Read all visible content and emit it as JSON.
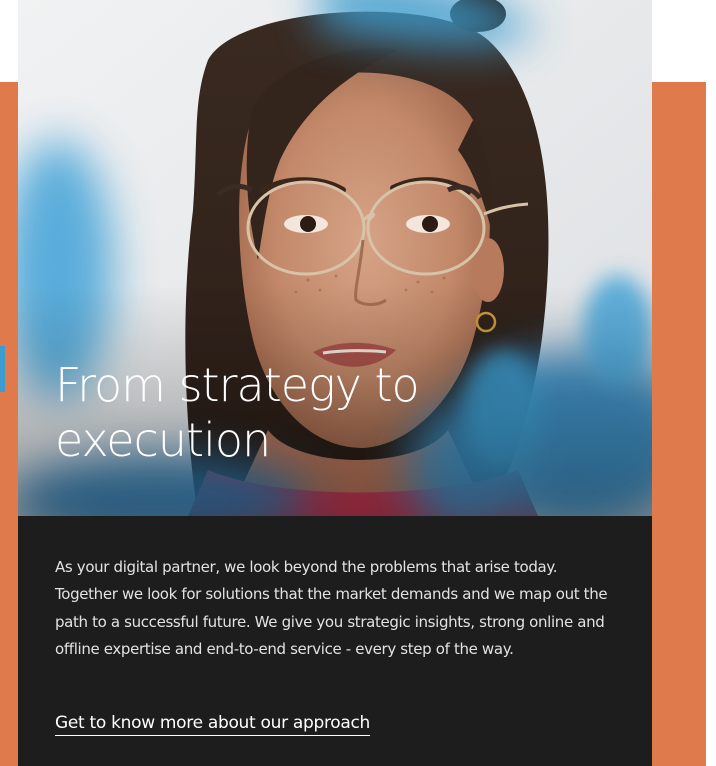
{
  "hero": {
    "title": "From strategy to\nexecution",
    "image_description_name": "portrait-photo"
  },
  "content": {
    "paragraph": "As your digital partner, we look beyond the problems that arise today. Together we look for solutions that the market demands and we map out the path to a successful future. We give you strategic insights, strong online and offline expertise and end-to-end service - every step of the way.",
    "link_label": "Get to know more about our approach"
  },
  "colors": {
    "accent_orange": "#de7a4b",
    "panel_dark": "#1d1d1d",
    "blur_blue": "#3d9ccf"
  }
}
